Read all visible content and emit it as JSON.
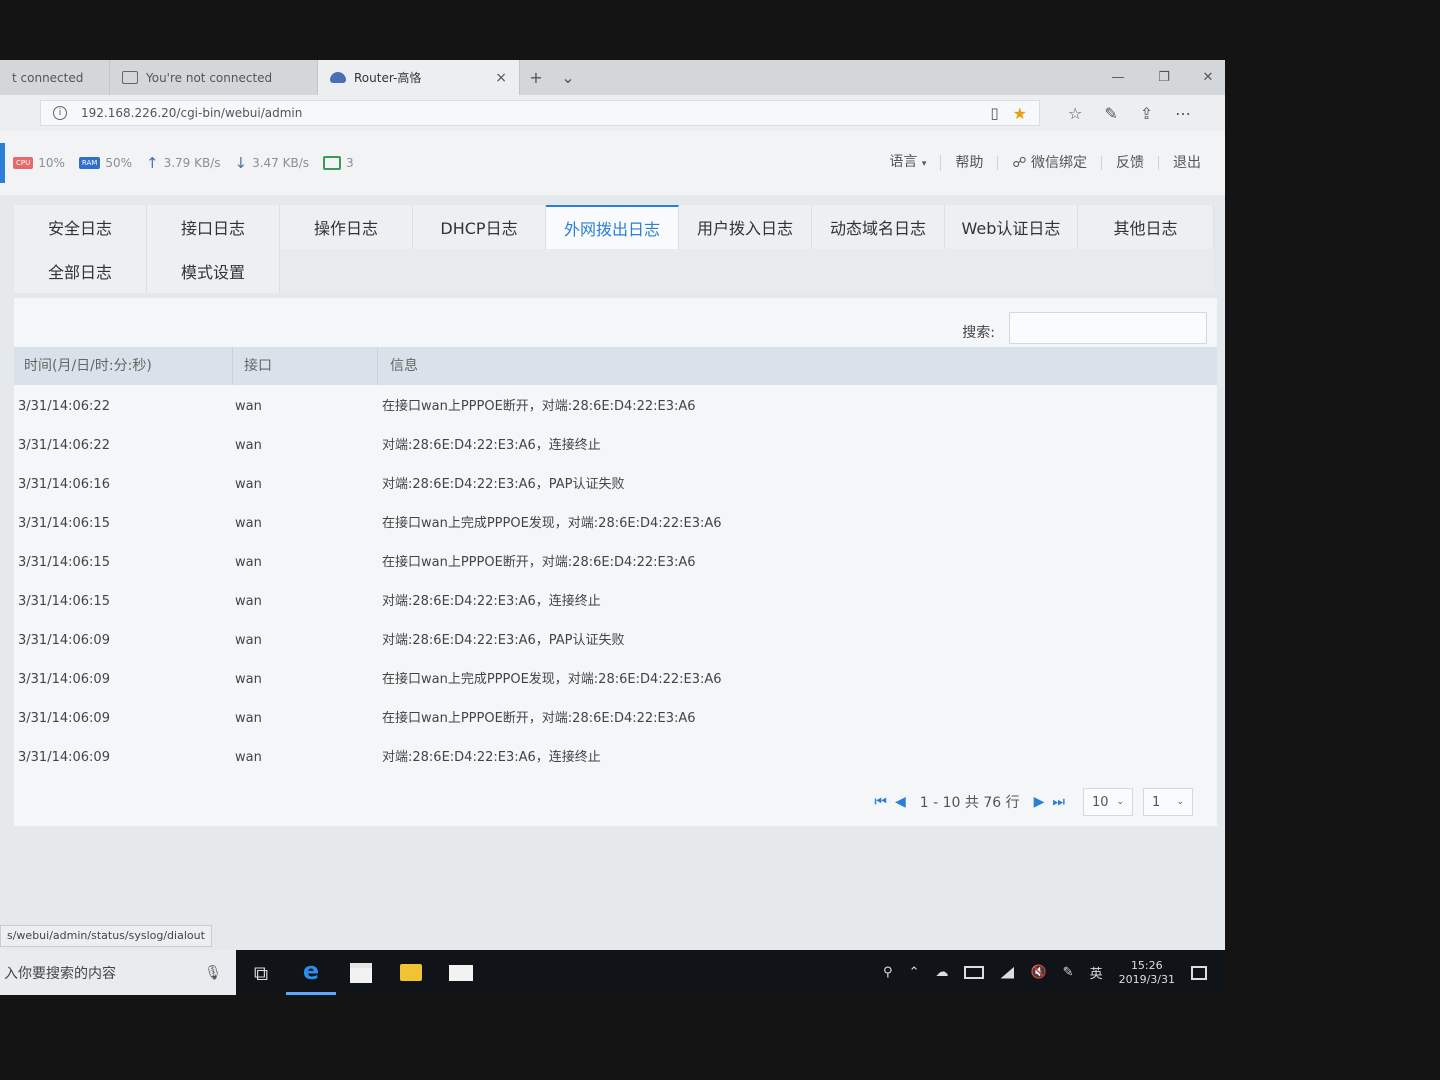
{
  "browser": {
    "tabs": [
      {
        "title": "t connected"
      },
      {
        "title": "You're not connected"
      },
      {
        "title": "Router-高恪"
      }
    ],
    "tab_close": "×",
    "new_tab": "+",
    "tab_list": "⌄",
    "window": {
      "minimize": "—",
      "maximize": "❐",
      "close": "✕"
    },
    "address": "192.168.226.20/cgi-bin/webui/admin",
    "status_url": "s/webui/admin/status/syslog/dialout"
  },
  "status": {
    "cpu_label": "CPU",
    "cpu": "10%",
    "ram_label": "RAM",
    "ram": "50%",
    "upload": "3.79 KB/s",
    "download": "3.47 KB/s",
    "terminals": "3",
    "menu": {
      "language": "语言",
      "help": "帮助",
      "wechat": "微信绑定",
      "feedback": "反馈",
      "logout": "退出"
    }
  },
  "log_tabs": [
    "安全日志",
    "接口日志",
    "操作日志",
    "DHCP日志",
    "外网拨出日志",
    "用户拨入日志",
    "动态域名日志",
    "Web认证日志",
    "其他日志",
    "全部日志",
    "模式设置"
  ],
  "active_tab_index": 4,
  "search": {
    "label": "搜索:",
    "value": ""
  },
  "table": {
    "headers": [
      "时间(月/日/时:分:秒)",
      "接口",
      "信息"
    ],
    "rows": [
      [
        "3/31/14:06:22",
        "wan",
        "在接口wan上PPPOE断开，对端:28:6E:D4:22:E3:A6"
      ],
      [
        "3/31/14:06:22",
        "wan",
        "对端:28:6E:D4:22:E3:A6，连接终止"
      ],
      [
        "3/31/14:06:16",
        "wan",
        "对端:28:6E:D4:22:E3:A6，PAP认证失败"
      ],
      [
        "3/31/14:06:15",
        "wan",
        "在接口wan上完成PPPOE发现，对端:28:6E:D4:22:E3:A6"
      ],
      [
        "3/31/14:06:15",
        "wan",
        "在接口wan上PPPOE断开，对端:28:6E:D4:22:E3:A6"
      ],
      [
        "3/31/14:06:15",
        "wan",
        "对端:28:6E:D4:22:E3:A6，连接终止"
      ],
      [
        "3/31/14:06:09",
        "wan",
        "对端:28:6E:D4:22:E3:A6，PAP认证失败"
      ],
      [
        "3/31/14:06:09",
        "wan",
        "在接口wan上完成PPPOE发现，对端:28:6E:D4:22:E3:A6"
      ],
      [
        "3/31/14:06:09",
        "wan",
        "在接口wan上PPPOE断开，对端:28:6E:D4:22:E3:A6"
      ],
      [
        "3/31/14:06:09",
        "wan",
        "对端:28:6E:D4:22:E3:A6，连接终止"
      ]
    ]
  },
  "pager": {
    "summary": "1 - 10 共 76 行",
    "page_size": "10",
    "page": "1"
  },
  "taskbar": {
    "search_placeholder": "入你要搜索的内容",
    "ime": "英",
    "time": "15:26",
    "date": "2019/3/31"
  },
  "colors": {
    "accent": "#2b7fd4",
    "cpu_chip": "#e66a6a",
    "ram_chip": "#2f6fc9"
  }
}
